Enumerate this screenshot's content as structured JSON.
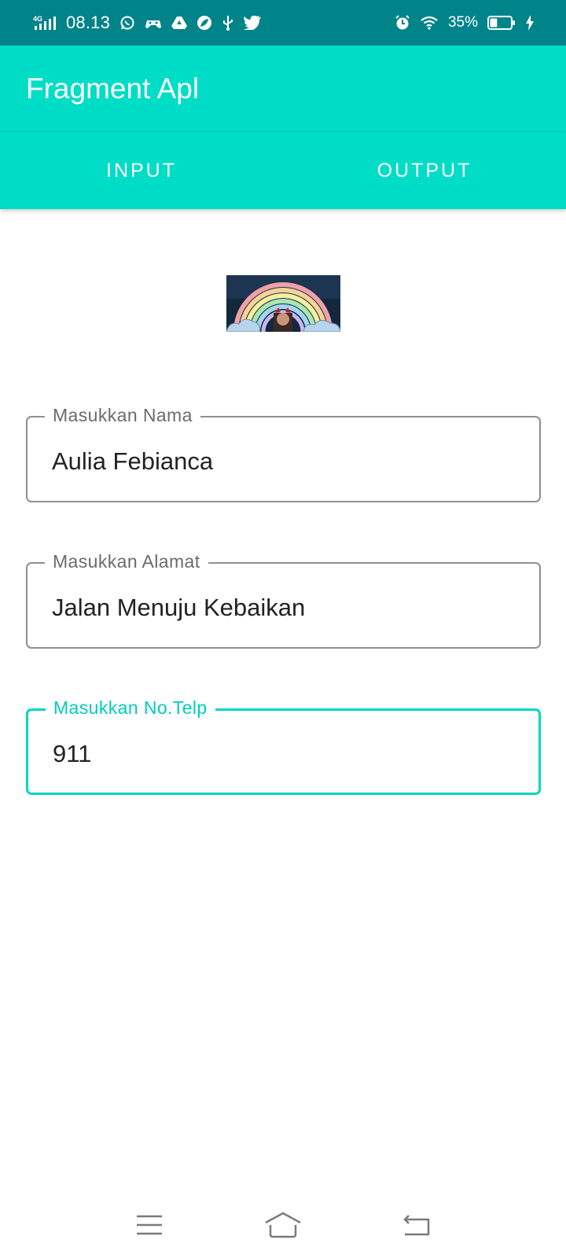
{
  "status_bar": {
    "network": "4G",
    "time": "08.13",
    "battery_percent": "35%",
    "battery_level": 0.35,
    "notification_icons": [
      "whatsapp-icon",
      "game-controller-icon",
      "drive-icon",
      "leaf-icon",
      "usb-icon",
      "twitter-icon"
    ],
    "right_icons": [
      "alarm-icon",
      "wifi-icon",
      "battery-icon",
      "charging-icon"
    ]
  },
  "app_bar": {
    "title": "Fragment Apl"
  },
  "tabs": [
    {
      "label": "INPUT"
    },
    {
      "label": "OUTPUT"
    }
  ],
  "form": {
    "name": {
      "label": "Masukkan Nama",
      "value": "Aulia Febianca"
    },
    "address": {
      "label": "Masukkan Alamat",
      "value": "Jalan Menuju Kebaikan"
    },
    "phone": {
      "label": "Masukkan No.Telp",
      "value": "911"
    }
  },
  "nav_bar": {
    "buttons": [
      "menu-icon",
      "home-icon",
      "back-icon"
    ]
  },
  "colors": {
    "status_bar": "#00848a",
    "primary": "#00ddc6",
    "accent": "#00d6c4",
    "outline": "#8f8f8f"
  }
}
